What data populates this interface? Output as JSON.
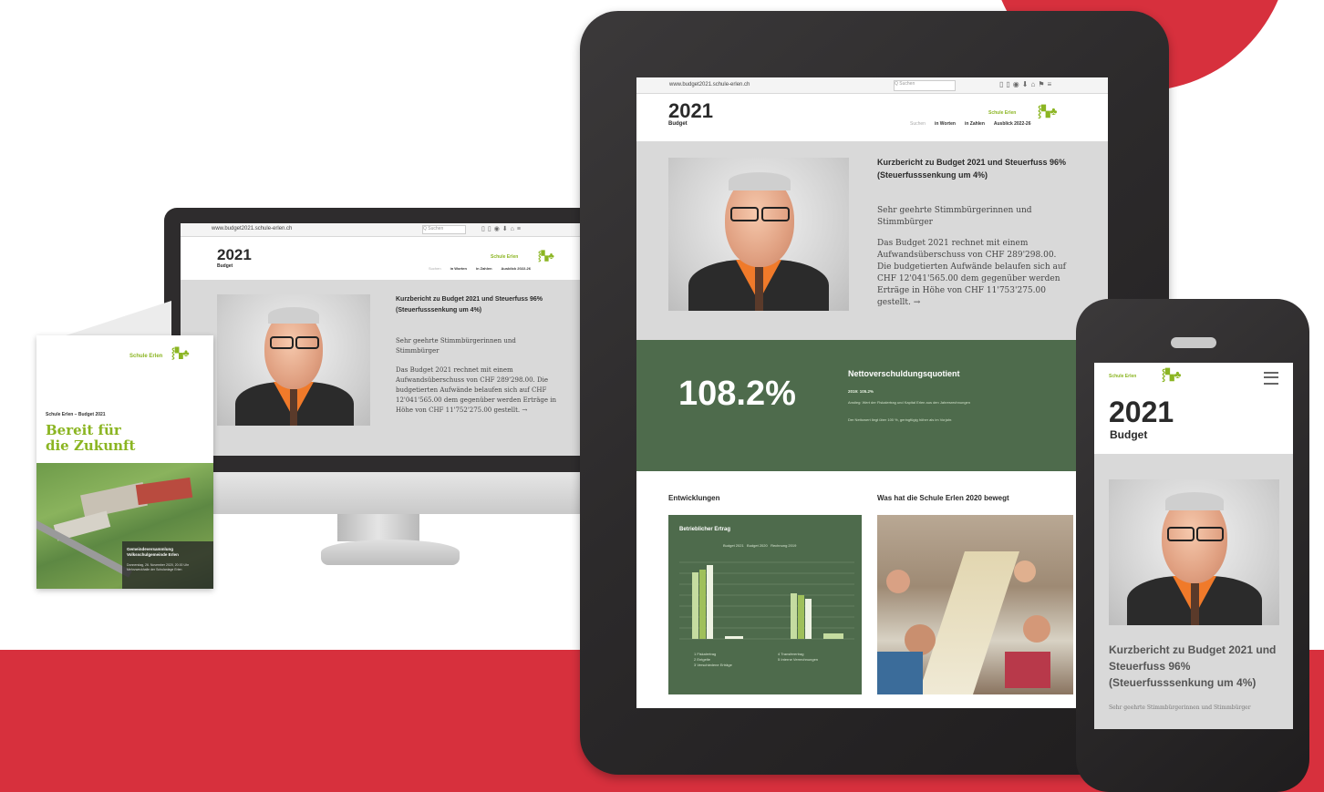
{
  "desktop": {
    "url": "www.budget2021.schule-erlen.ch",
    "search_placeholder": "Q Suchen",
    "logo_text": "Schule Erlen",
    "heading_year": "2021",
    "heading_sub": "Budget",
    "nav": [
      "Suchen",
      "in Worten",
      "in Zahlen",
      "Ausblick 2022-26"
    ],
    "title": "Kurzbericht zu Budget 2021 und Steuerfuss 96% (Steuerfusssenkung um 4%)",
    "greeting": "Sehr geehrte Stimmbürgerinnen und Stimmbürger",
    "body": "Das Budget 2021 rechnet mit einem Aufwandsüberschuss von CHF 289'298.00. Die budgetierten Aufwände belaufen sich auf CHF 12'041'565.00 dem gegenüber werden Erträge in Höhe von CHF 11'752'275.00 gestellt. →"
  },
  "brochure": {
    "logo_text": "Schule Erlen",
    "kicker": "Schule Erlen – Budget 2021",
    "title_line1": "Bereit für",
    "title_line2": "die Zukunft",
    "caption_title": "Gemeindeversammlung Volksschulgemeinde Erlen",
    "caption_sub": "Donnerstag, 26. November 2020, 20.00 Uhr Mehrzweckhalle der Schulanlage Erlen"
  },
  "tablet": {
    "url": "www.budget2021.schule-erlen.ch",
    "search_placeholder": "Q Suchen",
    "logo_text": "Schule Erlen",
    "heading_year": "2021",
    "heading_sub": "Budget",
    "nav": [
      "Suchen",
      "in Worten",
      "in Zahlen",
      "Ausblick 2022-26"
    ],
    "title": "Kurzbericht zu Budget 2021 und Steuerfuss 96% (Steuerfusssenkung um 4%)",
    "greeting": "Sehr geehrte Stimmbürgerinnen und Stimmbürger",
    "body": "Das Budget 2021 rechnet mit einem Aufwandsüberschuss von CHF 289'298.00. Die budgetierten Aufwände belaufen sich auf CHF 12'041'565.00 dem gegenüber werden Erträge in Höhe von CHF 11'753'275.00 gestellt. →",
    "metric_value": "108.2%",
    "metric_title": "Nettoverschuldungsquotient",
    "metric_line1": "2019: 105.2%",
    "metric_line2": "Anstieg: Wert der Fiskalertrag und Kapital Erlen aus den Jahresrechnungen",
    "metric_line3": "Der Nettowert liegt über 100 %, geringfügig höher als im Vorjahr.",
    "section_left": "Entwicklungen",
    "section_right": "Was hat die Schule Erlen 2020 bewegt",
    "chart_title": "Betrieblicher Ertrag",
    "chart_series": [
      "Budget 2021",
      "Budget 2020",
      "Rechnung 2019"
    ],
    "chart_legend": [
      "1 Fiskalertrag",
      "2 Entgelte",
      "3 Verschiedene Erträge",
      "4 Transferertrag",
      "5 Interne Verrechnungen"
    ]
  },
  "phone": {
    "logo_text": "Schule Erlen",
    "heading_year": "2021",
    "heading_sub": "Budget",
    "title": "Kurzbericht zu Budget 2021 und Steuerfuss 96% (Steuerfusssenkung um 4%)",
    "greeting": "Sehr geehrte Stimmbürgerinnen und Stimmbürger"
  },
  "colors": {
    "brand_red": "#d7303d",
    "brand_green": "#8bb522",
    "band_green": "#4e6b4c",
    "device_dark": "#2d2b2c"
  }
}
